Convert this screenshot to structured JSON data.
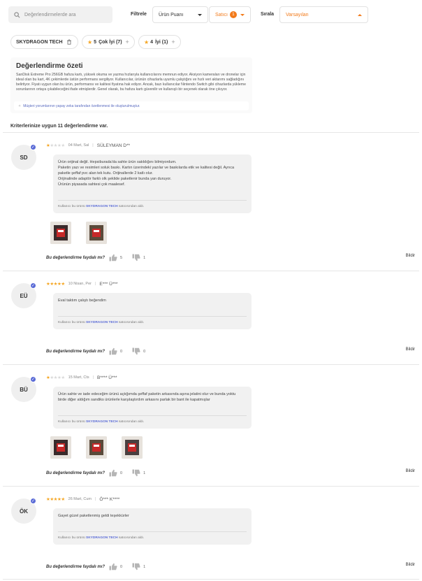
{
  "search": {
    "placeholder": "Değerlendirmelerde ara"
  },
  "filters": {
    "filter_label": "Filtrele",
    "rating_select": "Ürün Puanı",
    "photo_select": "Satıcı",
    "photo_badge": "1",
    "sort_label": "Sırala",
    "sort_select": "Varsayılan",
    "accent": "#f27a1a"
  },
  "chips": [
    {
      "label": "SKYDRAGON TECH",
      "icon": "trash-icon"
    },
    {
      "label": "Çok İyi (7)",
      "star": "5"
    },
    {
      "label": "İyi (1)",
      "star": "4"
    }
  ],
  "summary": {
    "title": "Değerlendirme özeti",
    "text": "SanDisk Extreme Pro 256GB hafıza kartı, yüksek okuma ve yazma hızlarıyla kullanıcılarını memnun ediyor. Aksiyon kameraları ve dronelar için ideal olan bu kart, 4K çekimlerde üstün performans sergiliyor. Kullanıcılar, ürünün cihazlarla uyumlu çalıştığını ve hızlı veri aktarımı sağladığını belirtiyor. Fiyatı uygun olan bu ürün, performansı ve kalitesi fiyatına hak ediyor. Ancak, bazı kullanıcılar Nintendo Switch gibi cihazlarda yükleme sorunlarının ortaya çıkabileceğini ifade etmişlerdir. Genel olarak, bu hafıza kartı güvenilir ve kullanışlı bir seçenek olarak öne çıkıyor.",
    "note": "Müşteri yorumlarının yapay zeka tarafından özetlenmesi ile oluşturulmuştur."
  },
  "results_count": "Kriterlerinize uygun 11 değerlendirme var.",
  "helpful_question": "Bu değerlendirme faydalı mı?",
  "report_label": "Bildir",
  "reviews": [
    {
      "initials": "SD",
      "rating": 1,
      "date": "04 Mart, Sal",
      "author": "SÜLEYMAN D**",
      "lines": [
        "Ürün orijinal değil. Hepsiburada'da sahte ürün satıldığını bilmiyordum.",
        "Paketin yazı ve resimleri soluk baskı. Kartın üzerindeki yazılar ve baskılarda etik ve kalitesi değil. Ayrıca",
        "paketle şeffaf pvc alan tek kutu. Orijinallerde 2 katlı olur.",
        "Orijinalinde adaptör farklı olk şeklide paketlenir bunda yan duruyor.",
        "Ürünün piyasada sahtesi çok maalesef."
      ],
      "seller": "SKYDRAGON TECH",
      "seller_prefix": "Kullanıcı bu ürünü",
      "seller_suffix": "satıcısından aldı.",
      "photos": 2,
      "likes": "5",
      "dislikes": "1"
    },
    {
      "initials": "EÜ",
      "rating": 5,
      "date": "10 Nisan, Per",
      "author": "E*** Ü***",
      "lines": [
        "Eval taktım çalıştı beğendim"
      ],
      "seller": "SKYDRAGON TECH",
      "seller_prefix": "Kullanıcı bu ürünü",
      "seller_suffix": "satıcısından aldı.",
      "photos": 0,
      "likes": "0",
      "dislikes": "0"
    },
    {
      "initials": "BÜ",
      "rating": 1,
      "date": "15 Mart, Cts",
      "author": "B**** Ü***",
      "lines": [
        "Ürün sahte ve iade edeceğim ürünü açtığımda şeffaf paketin arkasında aşına jelatini olur ve bunda yoktu",
        "birde diğer aldığım sandiks ürünlerle karşılaştırdım arkasını parlak bir bant ile kapatmışlar"
      ],
      "seller": "SKYDRAGON TECH",
      "seller_prefix": "Kullanıcı bu ürünü",
      "seller_suffix": "satıcısından aldı.",
      "photos": 3,
      "likes": "0",
      "dislikes": "1"
    },
    {
      "initials": "ÖK",
      "rating": 5,
      "date": "26 Mart, Cum",
      "author": "Ö*** K****",
      "lines": [
        "Gayet güzel paketlenmiş geldi teşekkürler"
      ],
      "seller": "SKYDRAGON TECH",
      "seller_prefix": "Kullanıcı bu ürünü",
      "seller_suffix": "satıcısından aldı.",
      "photos": 0,
      "likes": "0",
      "dislikes": "1"
    }
  ]
}
